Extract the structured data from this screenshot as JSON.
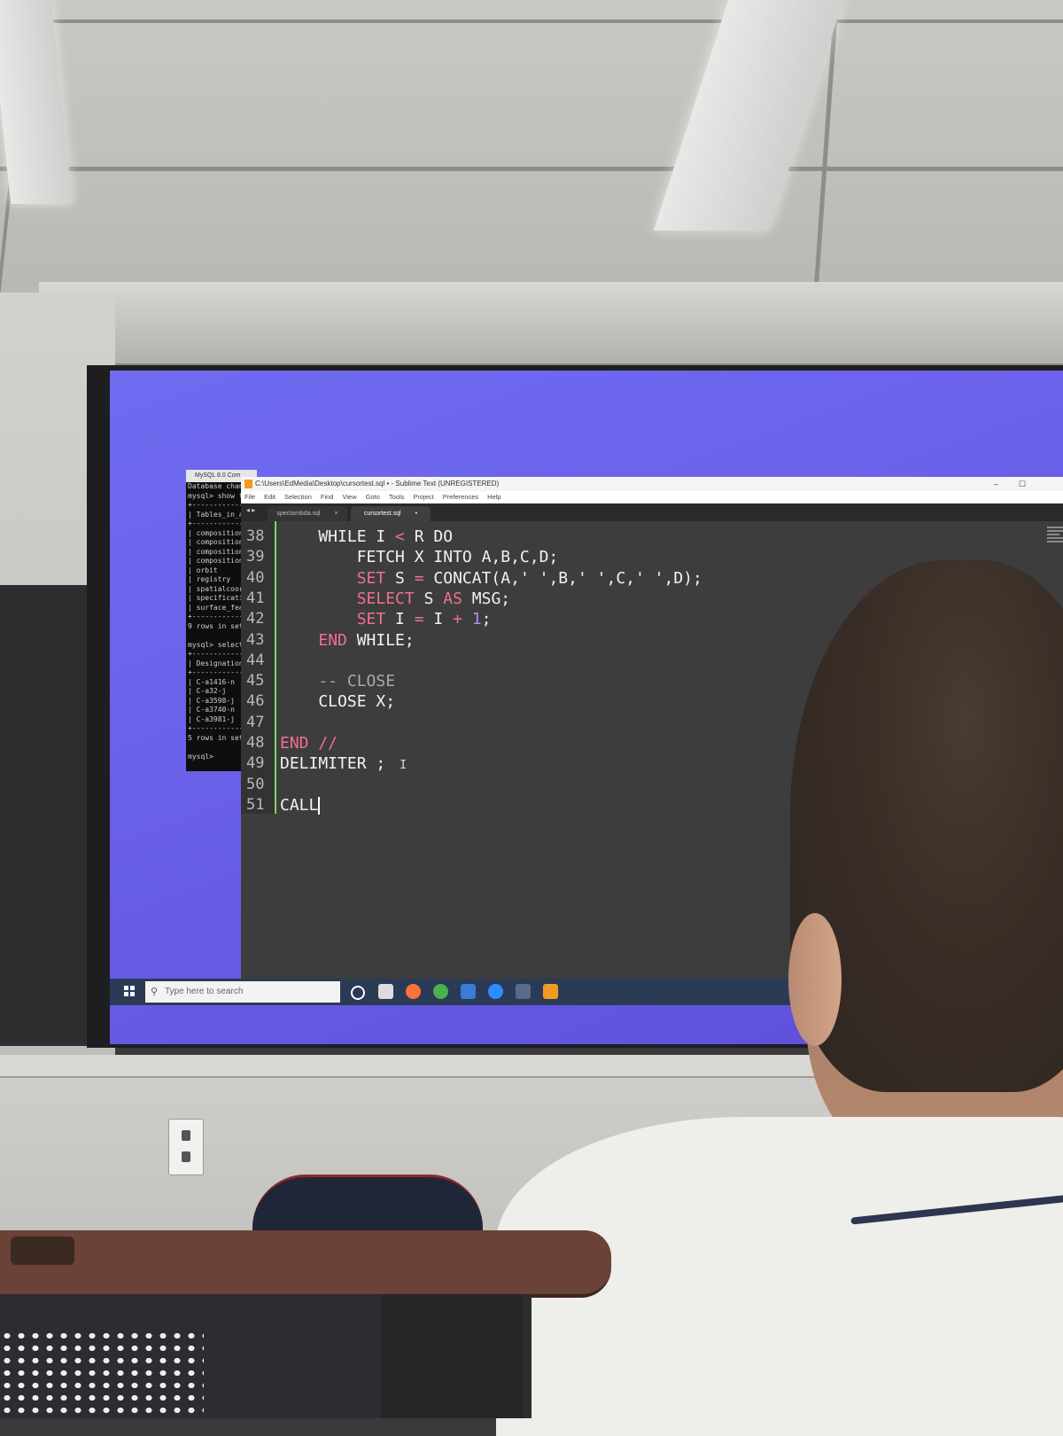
{
  "console": {
    "title": "MySQL 8.0 Com",
    "lines": [
      "Database chang",
      "mysql> show ta",
      "+--------------",
      "| Tables_in_as",
      "+--------------",
      "| composition_",
      "| composition_",
      "| composition_",
      "| composition_",
      "| orbit",
      "| registry",
      "| spatialcoord",
      "| specificatio",
      "| surface_feat",
      "+--------------",
      "9 rows in set",
      "",
      "mysql> select",
      "+--------------",
      "| Designation",
      "+--------------",
      "| C-a1416-n",
      "| C-a32-j",
      "| C-a3598-j",
      "| C-a3740-n",
      "| C-a3981-j",
      "+--------------",
      "5 rows in set",
      "",
      "mysql>"
    ]
  },
  "sublime": {
    "title": "C:\\Users\\EdMedia\\Desktop\\cursortest.sql • - Sublime Text (UNREGISTERED)",
    "menu": [
      "File",
      "Edit",
      "Selection",
      "Find",
      "View",
      "Goto",
      "Tools",
      "Project",
      "Preferences",
      "Help"
    ],
    "tabs": [
      {
        "label": "spectambda.sql",
        "close": "×"
      },
      {
        "label": "cursortest.sql",
        "close": "•"
      }
    ],
    "lines": [
      {
        "num": "38",
        "tokens": [
          {
            "t": "    WHILE I ",
            "c": ""
          },
          {
            "t": "<",
            "c": "op"
          },
          {
            "t": " R DO",
            "c": ""
          }
        ]
      },
      {
        "num": "39",
        "tokens": [
          {
            "t": "        FETCH X INTO A,B,C,D;",
            "c": ""
          }
        ]
      },
      {
        "num": "40",
        "tokens": [
          {
            "t": "        ",
            "c": ""
          },
          {
            "t": "SET",
            "c": "kw"
          },
          {
            "t": " S ",
            "c": ""
          },
          {
            "t": "=",
            "c": "op"
          },
          {
            "t": " CONCAT(A,' ',B,' ',C,' ',D);",
            "c": ""
          }
        ]
      },
      {
        "num": "41",
        "tokens": [
          {
            "t": "        ",
            "c": ""
          },
          {
            "t": "SELECT",
            "c": "kw"
          },
          {
            "t": " S ",
            "c": ""
          },
          {
            "t": "AS",
            "c": "kw"
          },
          {
            "t": " MSG;",
            "c": ""
          }
        ]
      },
      {
        "num": "42",
        "tokens": [
          {
            "t": "        ",
            "c": ""
          },
          {
            "t": "SET",
            "c": "kw"
          },
          {
            "t": " I ",
            "c": ""
          },
          {
            "t": "=",
            "c": "op"
          },
          {
            "t": " I ",
            "c": ""
          },
          {
            "t": "+",
            "c": "op"
          },
          {
            "t": " ",
            "c": ""
          },
          {
            "t": "1",
            "c": "nm"
          },
          {
            "t": ";",
            "c": ""
          }
        ]
      },
      {
        "num": "43",
        "tokens": [
          {
            "t": "    ",
            "c": ""
          },
          {
            "t": "END",
            "c": "kw"
          },
          {
            "t": " WHILE;",
            "c": ""
          }
        ]
      },
      {
        "num": "44",
        "tokens": []
      },
      {
        "num": "45",
        "tokens": [
          {
            "t": "    -- CLOSE",
            "c": "cm"
          }
        ]
      },
      {
        "num": "46",
        "tokens": [
          {
            "t": "    CLOSE X;",
            "c": ""
          }
        ]
      },
      {
        "num": "47",
        "tokens": []
      },
      {
        "num": "48",
        "tokens": [
          {
            "t": "END //",
            "c": "kw"
          }
        ]
      },
      {
        "num": "49",
        "tokens": [
          {
            "t": "DELIMITER ;",
            "c": ""
          }
        ],
        "ibeam": "I"
      },
      {
        "num": "50",
        "tokens": []
      },
      {
        "num": "51",
        "tokens": [
          {
            "t": "CALL",
            "c": ""
          }
        ],
        "caret": true
      }
    ]
  },
  "taskbar": {
    "search_placeholder": "Type here to search",
    "icons": [
      {
        "name": "cortana-icon",
        "color": "#ffffff"
      },
      {
        "name": "task-view-icon",
        "color": "#dddddd"
      },
      {
        "name": "firefox-icon",
        "color": "#ff7139"
      },
      {
        "name": "chrome-icon",
        "color": "#4caf50"
      },
      {
        "name": "edge-icon",
        "color": "#3a7bd5"
      },
      {
        "name": "zoom-icon",
        "color": "#2d8cff"
      },
      {
        "name": "mysql-icon",
        "color": "#5a6b8a"
      },
      {
        "name": "sublime-text-icon",
        "color": "#f29c1f"
      }
    ]
  }
}
